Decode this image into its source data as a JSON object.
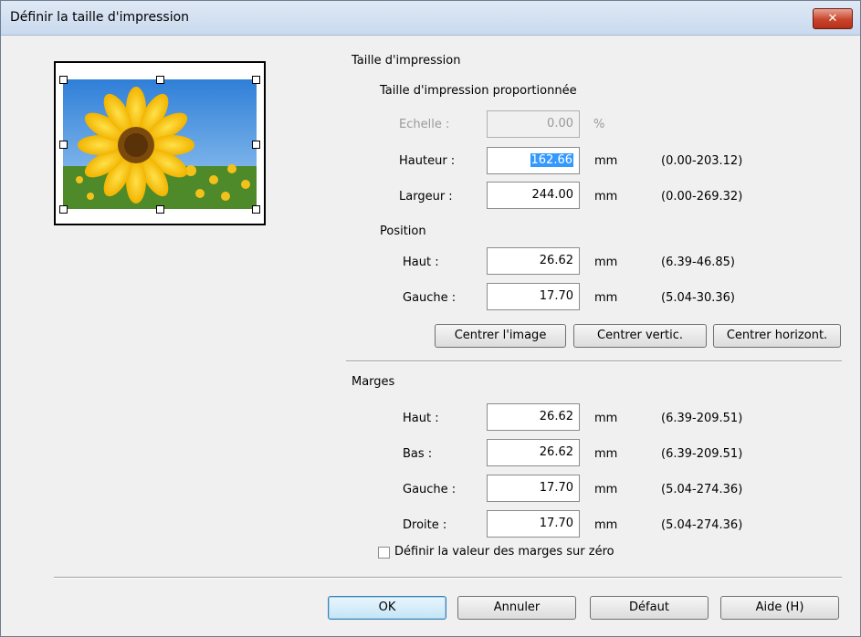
{
  "window": {
    "title": "Définir la taille d'impression",
    "close_glyph": "✕"
  },
  "print_size": {
    "group_label": "Taille d'impression",
    "proportional_label": "Taille d'impression proportionnée",
    "scale": {
      "label": "Echelle :",
      "value": "0.00",
      "unit": "%"
    },
    "height": {
      "label": "Hauteur :",
      "value": "162.66",
      "unit": "mm",
      "range": "(0.00-203.12)"
    },
    "width": {
      "label": "Largeur :",
      "value": "244.00",
      "unit": "mm",
      "range": "(0.00-269.32)"
    }
  },
  "position": {
    "label": "Position",
    "top": {
      "label": "Haut :",
      "value": "26.62",
      "unit": "mm",
      "range": "(6.39-46.85)"
    },
    "left": {
      "label": "Gauche :",
      "value": "17.70",
      "unit": "mm",
      "range": "(5.04-30.36)"
    },
    "buttons": {
      "center_image": "Centrer l'image",
      "center_vertical": "Centrer vertic.",
      "center_horizontal": "Centrer horizont."
    }
  },
  "margins": {
    "label": "Marges",
    "top": {
      "label": "Haut :",
      "value": "26.62",
      "unit": "mm",
      "range": "(6.39-209.51)"
    },
    "bottom": {
      "label": "Bas :",
      "value": "26.62",
      "unit": "mm",
      "range": "(6.39-209.51)"
    },
    "left": {
      "label": "Gauche :",
      "value": "17.70",
      "unit": "mm",
      "range": "(5.04-274.36)"
    },
    "right": {
      "label": "Droite :",
      "value": "17.70",
      "unit": "mm",
      "range": "(5.04-274.36)"
    },
    "zero_checkbox_label": "Définir la valeur des marges sur zéro",
    "zero_checked": false
  },
  "footer": {
    "ok": "OK",
    "cancel": "Annuler",
    "default": "Défaut",
    "help": "Aide (H)"
  },
  "colors": {
    "accent_selection": "#3399ff",
    "close_button": "#c8442a"
  }
}
